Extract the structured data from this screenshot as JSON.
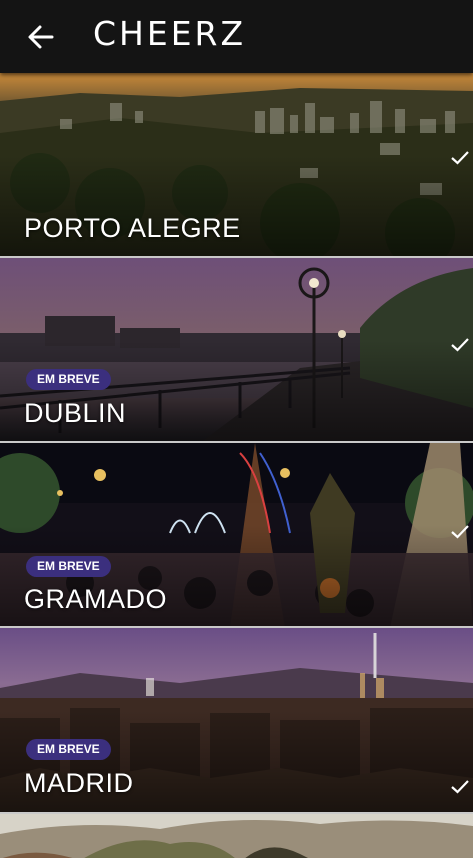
{
  "app": {
    "title": "CHEERZ"
  },
  "icons": {
    "back": "arrow-left-icon",
    "check": "checkmark-icon"
  },
  "colors": {
    "header_bg": "#141414",
    "badge_bg": "#3b2f7e"
  },
  "cities": [
    {
      "name": "PORTO ALEGRE",
      "badge": "",
      "selected": true
    },
    {
      "name": "DUBLIN",
      "badge": "EM BREVE",
      "selected": true
    },
    {
      "name": "GRAMADO",
      "badge": "EM BREVE",
      "selected": true
    },
    {
      "name": "MADRID",
      "badge": "EM BREVE",
      "selected": true
    },
    {
      "name": "",
      "badge": "",
      "selected": false
    }
  ]
}
